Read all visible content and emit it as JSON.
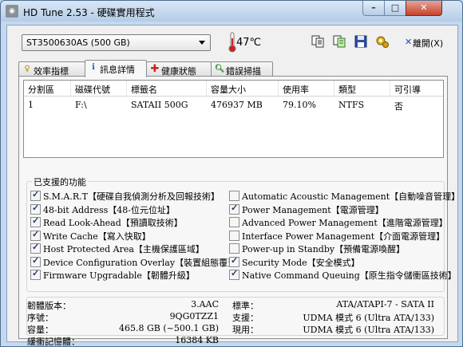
{
  "window": {
    "title": "HD Tune 2.53 - 硬碟實用程式"
  },
  "toolbar": {
    "drive_selected": "ST3500630AS (500 GB)",
    "temperature": "47℃",
    "exit_label": "離開(X)"
  },
  "tabs": [
    {
      "label": "效率指標",
      "icon": "benchmark-icon"
    },
    {
      "label": "訊息詳情",
      "icon": "info-icon",
      "active": true
    },
    {
      "label": "健康狀態",
      "icon": "health-cross-icon"
    },
    {
      "label": "錯誤掃描",
      "icon": "error-scan-icon"
    }
  ],
  "partitions": {
    "columns": [
      "分割區",
      "磁碟代號",
      "標籤名",
      "容量大小",
      "使用率",
      "類型",
      "可引導"
    ],
    "rows": [
      [
        "1",
        "F:\\",
        "SATAII 500G",
        "476937 MB",
        "79.10%",
        "NTFS",
        "否"
      ]
    ]
  },
  "features": {
    "title": "已支援的功能",
    "left": [
      {
        "label": "S.M.A.R.T【硬碟自我偵測分析及回報技術】",
        "checked": true
      },
      {
        "label": "48-bit Address【48-位元位址】",
        "checked": true
      },
      {
        "label": "Read Look-Ahead【預讀取技術】",
        "checked": true
      },
      {
        "label": "Write Cache【寫入快取】",
        "checked": true
      },
      {
        "label": "Host Protected Area【主機保護區域】",
        "checked": true
      },
      {
        "label": "Device Configuration Overlay【裝置組態覆蓋】",
        "checked": true
      },
      {
        "label": "Firmware Upgradable【韌體升級】",
        "checked": true
      }
    ],
    "right": [
      {
        "label": "Automatic Acoustic Management【自動噪音管理】",
        "checked": false
      },
      {
        "label": "Power Management【電源管理】",
        "checked": true
      },
      {
        "label": "Advanced Power Management【進階電源管理】",
        "checked": false
      },
      {
        "label": "Interface Power Management【介面電源管理】",
        "checked": false
      },
      {
        "label": "Power-up in Standby【預備電源喚醒】",
        "checked": false
      },
      {
        "label": "Security Mode【安全模式】",
        "checked": true
      },
      {
        "label": "Native Command Queuing【原生指令儲衝區技術】",
        "checked": true
      }
    ]
  },
  "info": {
    "firmware_label": "韌體版本：",
    "firmware_value": "3.AAC",
    "serial_label": "序號：",
    "serial_value": "9QG0TZZ1",
    "capacity_label": "容量：",
    "capacity_value": "465.8 GB (~500.1 GB)",
    "buffer_label": "緩衝記憶體：",
    "buffer_value": "16384 KB",
    "standard_label": "標準：",
    "standard_value": "ATA/ATAPI-7 - SATA II",
    "supported_label": "支援：",
    "supported_value": "UDMA 模式 6 (Ultra ATA/133)",
    "active_label": "現用：",
    "active_value": "UDMA 模式 6 (Ultra ATA/133)"
  }
}
